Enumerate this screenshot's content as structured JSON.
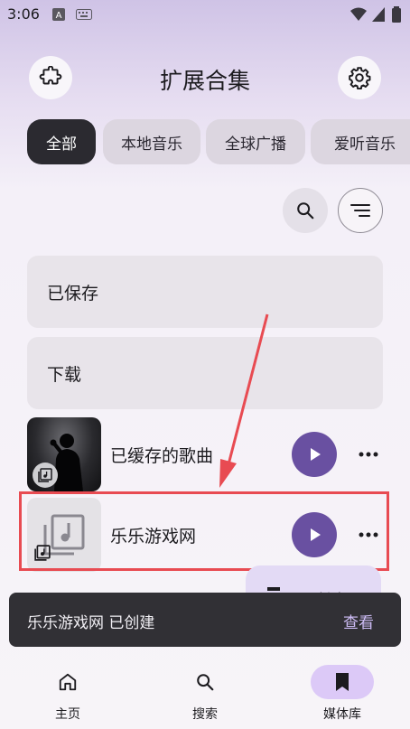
{
  "status_bar": {
    "time": "3:06"
  },
  "header": {
    "title": "扩展合集"
  },
  "chips": [
    "全部",
    "本地音乐",
    "全球广播",
    "爱听音乐"
  ],
  "cards": [
    {
      "label": "已保存"
    },
    {
      "label": "下载"
    }
  ],
  "rows": [
    {
      "title": "已缓存的歌曲"
    },
    {
      "title": "乐乐游戏网"
    }
  ],
  "fab": {
    "label": "创建"
  },
  "snackbar": {
    "message": "乐乐游戏网 已创建",
    "action": "查看"
  },
  "bottom_nav": [
    {
      "label": "主页",
      "icon": "home-icon"
    },
    {
      "label": "搜索",
      "icon": "search-icon"
    },
    {
      "label": "媒体库",
      "icon": "bookmark-icon"
    }
  ],
  "colors": {
    "accent": "#6950a1",
    "highlight": "#e84b52",
    "snackbar": "#313035"
  }
}
